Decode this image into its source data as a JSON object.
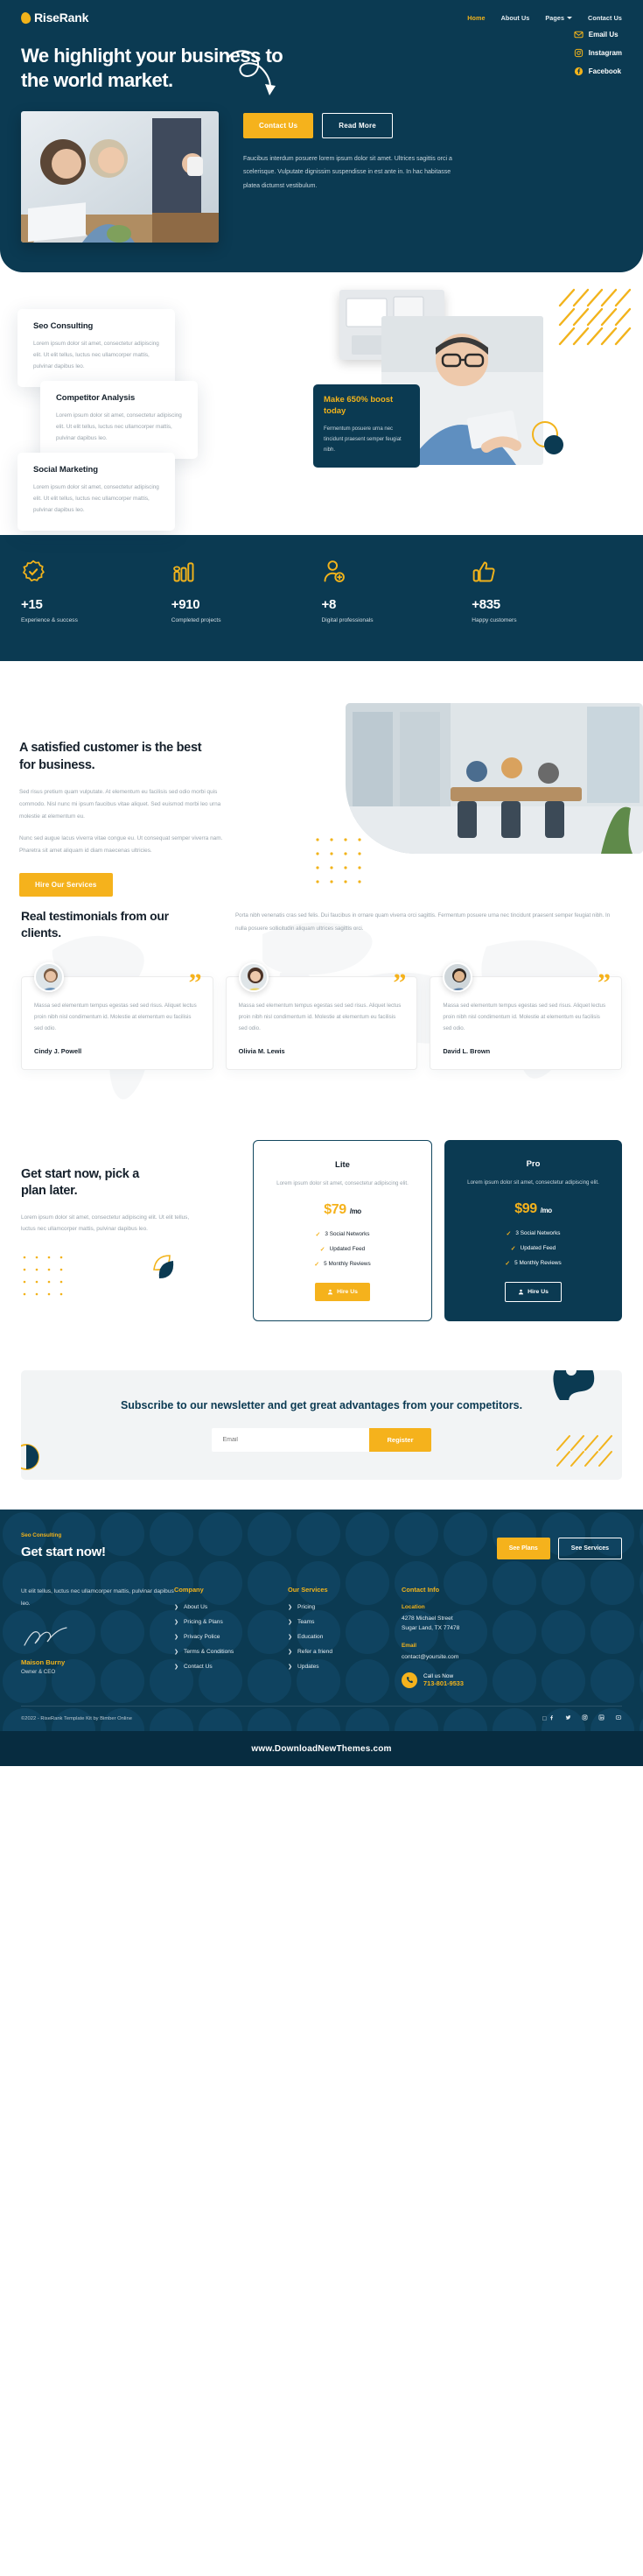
{
  "brand": {
    "name": "RiseRank",
    "accent": "#f2b31b",
    "navy": "#0b3a52"
  },
  "nav": {
    "items": [
      {
        "label": "Home",
        "active": true
      },
      {
        "label": "About Us",
        "active": false
      },
      {
        "label": "Pages",
        "active": false,
        "has_caret": true
      },
      {
        "label": "Contact Us",
        "active": false
      }
    ]
  },
  "hero": {
    "title": "We highlight your business to the world market.",
    "social": [
      {
        "label": "Email Us",
        "icon": "envelope-icon"
      },
      {
        "label": "Instagram",
        "icon": "instagram-icon"
      },
      {
        "label": "Facebook",
        "icon": "facebook-icon"
      }
    ],
    "primary_btn": "Contact Us",
    "secondary_btn": "Read More",
    "paragraph": "Faucibus interdum posuere lorem ipsum dolor sit amet. Ultrices sagittis orci a scelerisque. Vulputate dignissim suspendisse in est ante in. In hac habitasse platea dictumst vestibulum."
  },
  "services": {
    "cards": [
      {
        "title": "Seo Consulting",
        "text": "Lorem ipsum dolor sit amet, consectetur adipiscing elit. Ut elit tellus, luctus nec ullamcorper mattis, pulvinar dapibus leo."
      },
      {
        "title": "Competitor Analysis",
        "text": "Lorem ipsum dolor sit amet, consectetur adipiscing elit. Ut elit tellus, luctus nec ullamcorper mattis, pulvinar dapibus leo."
      },
      {
        "title": "Social Marketing",
        "text": "Lorem ipsum dolor sit amet, consectetur adipiscing elit. Ut elit tellus, luctus nec ullamcorper mattis, pulvinar dapibus leo."
      }
    ],
    "promo": {
      "title": "Make 650% boost today",
      "text": "Fermentum posuere urna nec tincidunt praesent semper feugiat nibh."
    }
  },
  "stats": [
    {
      "icon": "badge-check-icon",
      "value": "+15",
      "label": "Experience & success"
    },
    {
      "icon": "bar-chart-icon",
      "value": "+910",
      "label": "Completed projects"
    },
    {
      "icon": "user-plus-icon",
      "value": "+8",
      "label": "Digital professionals"
    },
    {
      "icon": "thumbs-up-icon",
      "value": "+835",
      "label": "Happy customers"
    }
  ],
  "satisfied": {
    "title": "A satisfied customer is the best for business.",
    "p1": "Sed risus pretium quam vulputate. At elementum eu facilisis sed odio morbi quis commodo. Nisl nunc mi ipsum faucibus vitae aliquet. Sed euismod morbi leo urna molestie at elementum eu.",
    "p2": "Nunc sed augue lacus viverra vitae congue eu. Ut consequat semper viverra nam. Pharetra sit amet aliquam id diam maecenas ultricies.",
    "button": "Hire Our Services"
  },
  "testimonials": {
    "title": "Real testimonials from our clients.",
    "intro": "Porta nibh venenatis cras sed felis. Dui faucibus in ornare quam viverra orci sagittis. Fermentum posuere urna nec tincidunt praesent semper feugiat nibh. In nulla posuere sollicitudin aliquam ultrices sagittis orci.",
    "quote_glyph": "”",
    "items": [
      {
        "text": "Massa sed elementum tempus egestas sed sed risus. Aliquet lectus proin nibh nisl condimentum id. Molestie at elementum eu facilisis sed odio.",
        "name": "Cindy J. Powell"
      },
      {
        "text": "Massa sed elementum tempus egestas sed sed risus. Aliquet lectus proin nibh nisl condimentum id. Molestie at elementum eu facilisis sed odio.",
        "name": "Olivia M. Lewis"
      },
      {
        "text": "Massa sed elementum tempus egestas sed sed risus. Aliquet lectus proin nibh nisl condimentum id. Molestie at elementum eu facilisis sed odio.",
        "name": "David L. Brown"
      }
    ]
  },
  "pricing": {
    "title": "Get start now, pick a plan later.",
    "text": "Lorem ipsum dolor sit amet, consectetur adipiscing elit. Ut elit tellus, luctus nec ullamcorper mattis, pulvinar dapibus leo.",
    "plans": [
      {
        "name": "Lite",
        "desc": "Lorem ipsum dolor sit amet, consectetur adipiscing elit.",
        "price": "$79",
        "period": "/mo",
        "features": [
          "3 Social Networks",
          "Updated Feed",
          "5 Monthly Reviews"
        ],
        "button": "Hire Us"
      },
      {
        "name": "Pro",
        "desc": "Lorem ipsum dolor sit amet, consectetur adipiscing elit.",
        "price": "$99",
        "period": "/mo",
        "features": [
          "3 Social Networks",
          "Updated Feed",
          "5 Monthly Reviews"
        ],
        "button": "Hire Us"
      }
    ]
  },
  "newsletter": {
    "heading": "Subscribe to our newsletter and get great advantages from your competitors.",
    "placeholder": "Email",
    "button": "Register"
  },
  "footer": {
    "eyebrow": "Seo Consulting",
    "heading": "Get start now!",
    "btn_primary": "See Plans",
    "btn_secondary": "See Services",
    "about_text": "Ut elit tellus, luctus nec ullamcorper mattis, pulvinar dapibus leo.",
    "signature_name": "Maison Burny",
    "signature_role": "Owner & CEO",
    "columns": [
      {
        "title": "Company",
        "links": [
          "About Us",
          "Pricing & Plans",
          "Privacy Police",
          "Terms & Conditions",
          "Contact Us"
        ]
      },
      {
        "title": "Our Services",
        "links": [
          "Pricing",
          "Teams",
          "Education",
          "Refer a friend",
          "Updates"
        ]
      }
    ],
    "contact": {
      "title": "Contact Info",
      "location_label": "Location",
      "location_line1": "4278 Michael Street",
      "location_line2": "Sugar Land, TX 77478",
      "email_label": "Email",
      "email_value": "contact@yoursite.com",
      "call_label": "Call us Now",
      "call_number": "713-801-9533",
      "phone_icon": "phone-icon"
    },
    "copyright": "©2022 - RiseRank Template Kit by Bimber Online",
    "socials": [
      "facebook-icon",
      "twitter-icon",
      "instagram-icon",
      "linkedin-icon",
      "youtube-icon"
    ],
    "bottom_bar": "www.DownloadNewThemes.com"
  }
}
